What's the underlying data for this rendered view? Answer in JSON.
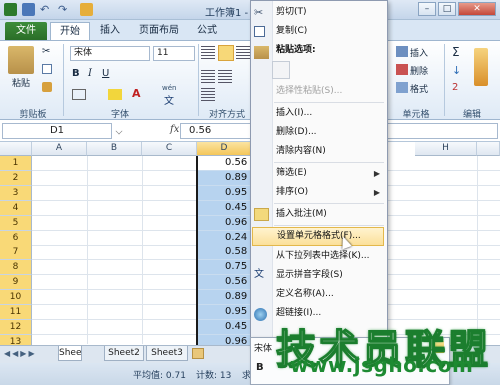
{
  "window": {
    "title": "工作簿1 - Mi"
  },
  "tabs": [
    {
      "label": "文件"
    },
    {
      "label": "开始"
    },
    {
      "label": "插入"
    },
    {
      "label": "页面布局"
    },
    {
      "label": "公式"
    }
  ],
  "ribbon": {
    "paste_label": "粘贴",
    "font_name": "宋体",
    "font_size": "11",
    "bold": "B",
    "italic": "I",
    "underline": "U",
    "wen": "wén",
    "wen_char": "文",
    "groups": {
      "clipboard": "剪贴板",
      "font": "字体",
      "align": "对齐方式",
      "cells": "单元格",
      "edit": "编辑"
    },
    "right": {
      "insert": "插入",
      "delete": "删除",
      "format": "格式",
      "sum": "Σ",
      "fill": "↓",
      "clear": "2"
    }
  },
  "formula_bar": {
    "name_box": "D1",
    "fx": "fx",
    "value": "0.56"
  },
  "columns": [
    "A",
    "B",
    "C",
    "D",
    "H"
  ],
  "rows": [
    "1",
    "2",
    "3",
    "4",
    "5",
    "6",
    "7",
    "8",
    "9",
    "10",
    "11",
    "12",
    "13",
    "14"
  ],
  "cells_d": [
    "0.56",
    "0.89",
    "0.95",
    "0.45",
    "0.96",
    "0.24",
    "0.58",
    "0.75",
    "0.56",
    "0.89",
    "0.95",
    "0.45",
    "0.96"
  ],
  "context_menu": {
    "items": {
      "cut": "剪切(T)",
      "copy": "复制(C)",
      "paste_options": "粘贴选项:",
      "paste_special": "选择性粘贴(S)...",
      "insert": "插入(I)...",
      "delete": "删除(D)...",
      "clear": "清除内容(N)",
      "filter": "筛选(E)",
      "sort": "排序(O)",
      "insert_comment": "插入批注(M)",
      "format_cells": "设置单元格格式(F)...",
      "pick_list": "从下拉列表中选择(K)...",
      "phonetic": "显示拼音字段(S)",
      "define_name": "定义名称(A)...",
      "hyperlink": "超链接(I)..."
    }
  },
  "sheets": [
    "Shee",
    "Sheet2",
    "Sheet3"
  ],
  "status": {
    "average": "平均值: 0.71",
    "count": "计数: 13",
    "sum": "求"
  },
  "mini_toolbar": {
    "font": "宋体",
    "bold": "B"
  },
  "watermark": {
    "text": "技术员联盟",
    "url": "www.jsgho.com"
  },
  "colors": {
    "file_tab": "#2a6e28",
    "selection": "#b7d3ef",
    "highlight": "#fbe09a",
    "watermark": "#1b7e2e"
  }
}
